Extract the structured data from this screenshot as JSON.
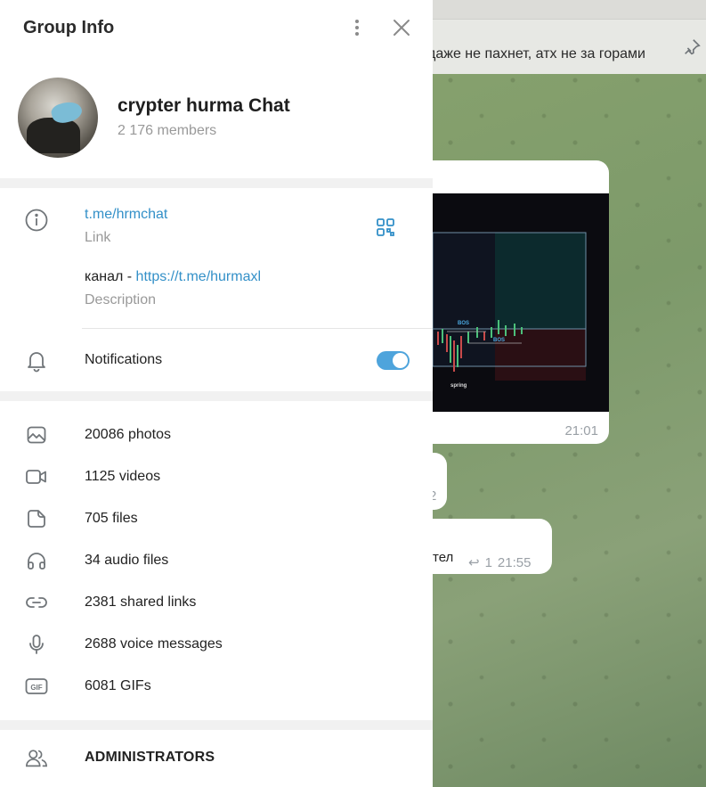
{
  "panel": {
    "title": "Group Info",
    "group_name": "crypter hurma Chat",
    "members": "2 176 members",
    "link": "t.me/hrmchat",
    "link_label": "Link",
    "description_prefix": "канал - ",
    "description_link": "https://t.me/hurmaxl",
    "description_label": "Description",
    "notifications_label": "Notifications",
    "notifications_on": true,
    "media": [
      {
        "icon": "photo-icon",
        "label": "20086 photos"
      },
      {
        "icon": "video-icon",
        "label": "1125 videos"
      },
      {
        "icon": "file-icon",
        "label": "705 files"
      },
      {
        "icon": "headphones-icon",
        "label": "34 audio files"
      },
      {
        "icon": "link-icon",
        "label": "2381 shared links"
      },
      {
        "icon": "microphone-icon",
        "label": "2688 voice messages"
      },
      {
        "icon": "gif-icon",
        "label": "6081 GIFs"
      }
    ],
    "administrators_label": "ADMINISTRATORS"
  },
  "chat": {
    "pinned_text": "даже не пахнет, атх не за горами",
    "message1_time": "21:01",
    "message2_partial": "2",
    "message3_text": "тел",
    "message3_reply_count": "1",
    "message3_time": "21:55",
    "chart_labels": [
      "BOS",
      "BOS",
      "spring"
    ]
  },
  "colors": {
    "accent": "#3390c8",
    "toggle_on": "#4ea4dc",
    "secondary_text": "#999999"
  }
}
